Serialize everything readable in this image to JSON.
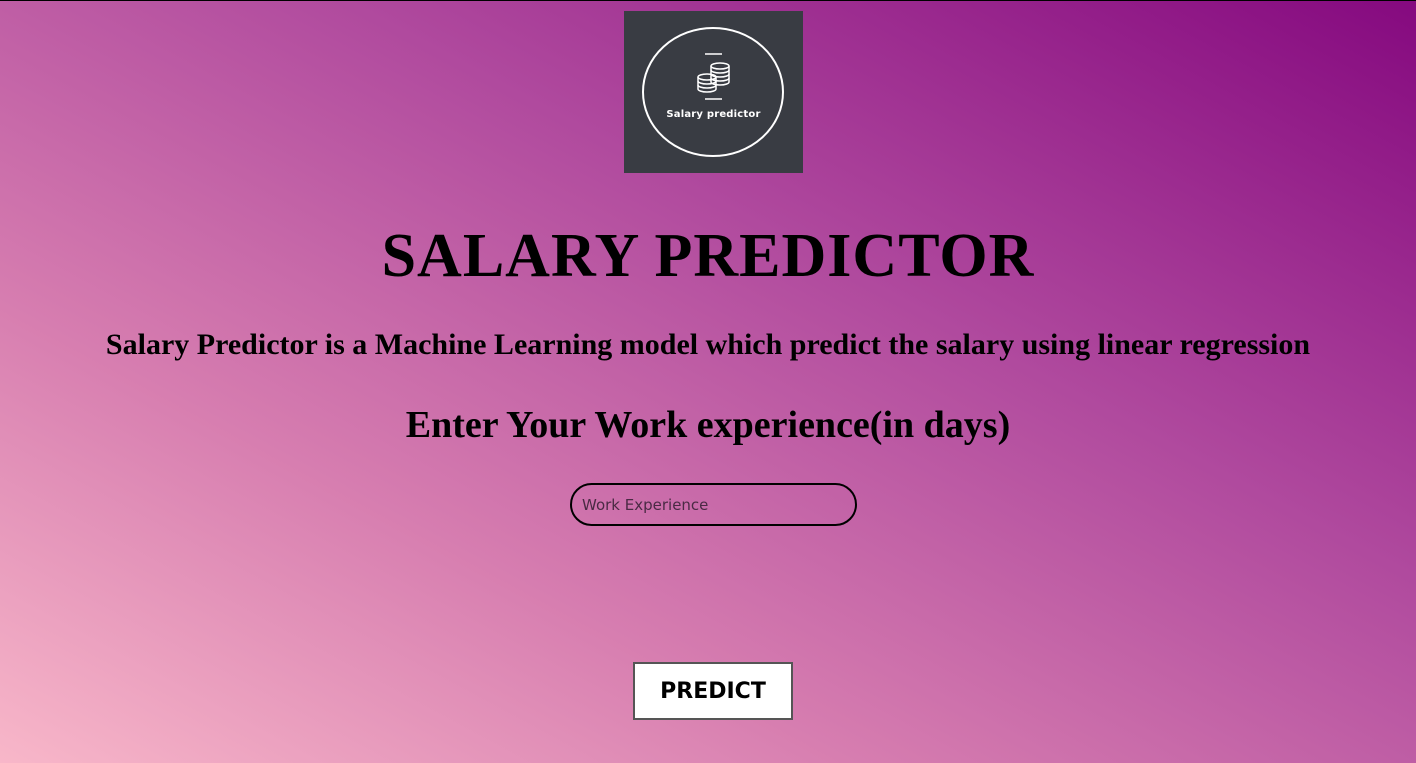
{
  "logo": {
    "text": "Salary predictor",
    "icon": "coins-stack-icon",
    "background_color": "#393c43"
  },
  "header": {
    "title": "SALARY PREDICTOR",
    "description": "Salary Predictor is a Machine Learning model which predict the salary using linear regression"
  },
  "form": {
    "prompt": "Enter Your Work experience(in days)",
    "experience_placeholder": "Work Experience",
    "experience_value": "",
    "predict_label": "PREDICT"
  },
  "colors": {
    "gradient_start": "#f8b7c9",
    "gradient_end": "#85097f",
    "text": "#000000"
  }
}
